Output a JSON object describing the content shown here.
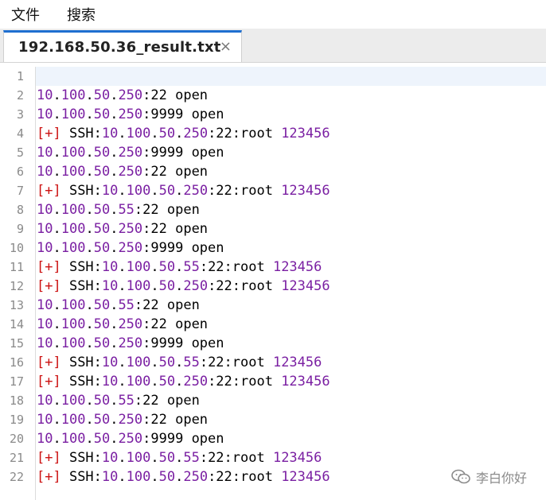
{
  "menu": {
    "file": "文件",
    "search": "搜索"
  },
  "tab": {
    "title": "192.168.50.36_result.txt",
    "close": "×"
  },
  "lines": [
    {
      "n": "1",
      "kind": "empty"
    },
    {
      "n": "2",
      "kind": "ip",
      "ip": "10.100.50.250",
      "port": "22",
      "status": "open"
    },
    {
      "n": "3",
      "kind": "ip",
      "ip": "10.100.50.250",
      "port": "9999",
      "status": "open"
    },
    {
      "n": "4",
      "kind": "ssh",
      "ip": "10.100.50.250",
      "port": "22",
      "user": "root",
      "password": "123456"
    },
    {
      "n": "5",
      "kind": "ip",
      "ip": "10.100.50.250",
      "port": "9999",
      "status": "open"
    },
    {
      "n": "6",
      "kind": "ip",
      "ip": "10.100.50.250",
      "port": "22",
      "status": "open"
    },
    {
      "n": "7",
      "kind": "ssh",
      "ip": "10.100.50.250",
      "port": "22",
      "user": "root",
      "password": "123456"
    },
    {
      "n": "8",
      "kind": "ip",
      "ip": "10.100.50.55",
      "port": "22",
      "status": "open"
    },
    {
      "n": "9",
      "kind": "ip",
      "ip": "10.100.50.250",
      "port": "22",
      "status": "open"
    },
    {
      "n": "10",
      "kind": "ip",
      "ip": "10.100.50.250",
      "port": "9999",
      "status": "open"
    },
    {
      "n": "11",
      "kind": "ssh",
      "ip": "10.100.50.55",
      "port": "22",
      "user": "root",
      "password": "123456"
    },
    {
      "n": "12",
      "kind": "ssh",
      "ip": "10.100.50.250",
      "port": "22",
      "user": "root",
      "password": "123456"
    },
    {
      "n": "13",
      "kind": "ip",
      "ip": "10.100.50.55",
      "port": "22",
      "status": "open"
    },
    {
      "n": "14",
      "kind": "ip",
      "ip": "10.100.50.250",
      "port": "22",
      "status": "open"
    },
    {
      "n": "15",
      "kind": "ip",
      "ip": "10.100.50.250",
      "port": "9999",
      "status": "open"
    },
    {
      "n": "16",
      "kind": "ssh",
      "ip": "10.100.50.55",
      "port": "22",
      "user": "root",
      "password": "123456"
    },
    {
      "n": "17",
      "kind": "ssh",
      "ip": "10.100.50.250",
      "port": "22",
      "user": "root",
      "password": "123456"
    },
    {
      "n": "18",
      "kind": "ip",
      "ip": "10.100.50.55",
      "port": "22",
      "status": "open"
    },
    {
      "n": "19",
      "kind": "ip",
      "ip": "10.100.50.250",
      "port": "22",
      "status": "open"
    },
    {
      "n": "20",
      "kind": "ip",
      "ip": "10.100.50.250",
      "port": "9999",
      "status": "open"
    },
    {
      "n": "21",
      "kind": "ssh",
      "ip": "10.100.50.55",
      "port": "22",
      "user": "root",
      "password": "123456"
    },
    {
      "n": "22",
      "kind": "ssh",
      "ip": "10.100.50.250",
      "port": "22",
      "user": "root",
      "password": "123456"
    }
  ],
  "ssh_prefix": "[+]",
  "ssh_label": "SSH",
  "watermark": {
    "icon": "wechat-icon",
    "text": "李白你好"
  },
  "colors": {
    "number": "#7a1fa2",
    "bracket": "#cc1111",
    "tab_accent": "#1f6fd0"
  }
}
